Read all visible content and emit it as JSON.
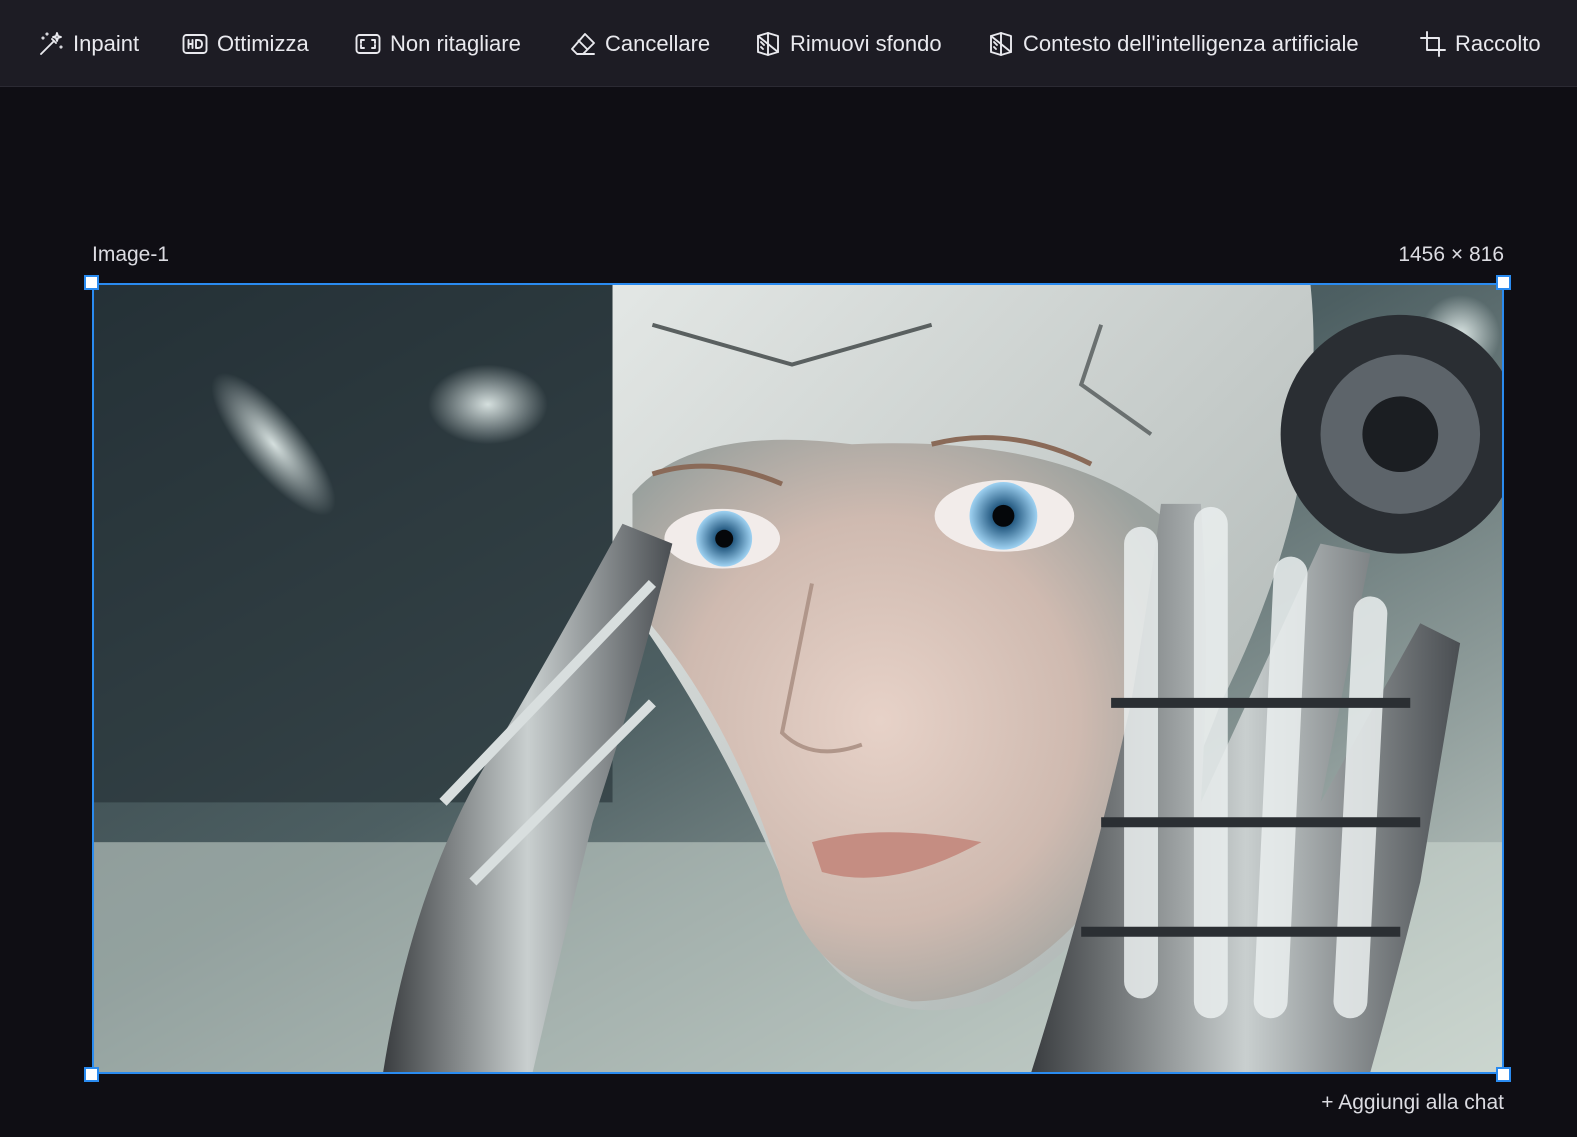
{
  "toolbar": {
    "items": [
      {
        "label": "Inpaint",
        "icon": "magic-wand-icon"
      },
      {
        "label": "Ottimizza",
        "icon": "hd-icon"
      },
      {
        "label": "Non ritagliare",
        "icon": "uncrop-icon"
      },
      {
        "label": "Cancellare",
        "icon": "eraser-icon"
      },
      {
        "label": "Rimuovi sfondo",
        "icon": "remove-background-icon"
      },
      {
        "label": "Contesto dell'intelligenza artificiale",
        "icon": "ai-context-icon"
      },
      {
        "label": "Raccolto",
        "icon": "crop-icon"
      }
    ]
  },
  "canvas": {
    "image_name": "Image-1",
    "image_size": "1456 × 816",
    "add_to_chat": "+ Aggiungi alla chat"
  },
  "colors": {
    "background": "#0f0e14",
    "toolbar": "#1d1c24",
    "selection": "#2a8bf0"
  }
}
